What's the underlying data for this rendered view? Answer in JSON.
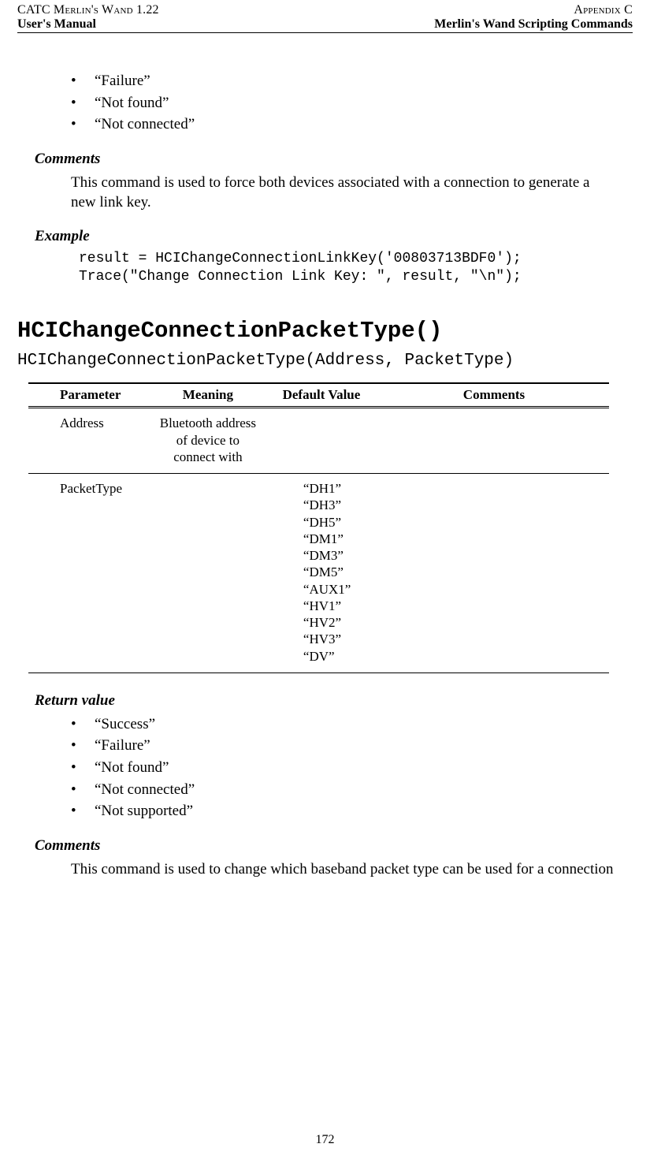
{
  "header": {
    "left_line1": "CATC Merlin's Wand 1.22",
    "left_line2": "User's Manual",
    "right_line1": "Appendix C",
    "right_line2": "Merlin's Wand Scripting Commands"
  },
  "top_bullets": [
    "“Failure”",
    "“Not found”",
    "“Not connected”"
  ],
  "section1": {
    "comments_label": "Comments",
    "comments_text": "This command is used to force both devices associated with a connection to generate a new link key.",
    "example_label": "Example",
    "example_code": "result = HCIChangeConnectionLinkKey('00803713BDF0');\nTrace(\"Change Connection Link Key: \", result, \"\\n\");"
  },
  "section2": {
    "heading": "HCIChangeConnectionPacketType()",
    "signature": "HCIChangeConnectionPacketType(Address, PacketType)",
    "table": {
      "headers": [
        "Parameter",
        "Meaning",
        "Default Value",
        "Comments"
      ],
      "rows": [
        {
          "parameter": "Address",
          "meaning": "Bluetooth address of device to connect with",
          "default_value": "",
          "comments": ""
        },
        {
          "parameter": "PacketType",
          "meaning": "",
          "default_value": "“DH1”\n“DH3”\n“DH5”\n“DM1”\n“DM3”\n“DM5”\n“AUX1”\n“HV1”\n“HV2”\n“HV3”\n“DV”",
          "comments": ""
        }
      ]
    },
    "return_label": "Return value",
    "return_bullets": [
      "“Success”",
      "“Failure”",
      "“Not found”",
      "“Not connected”",
      "“Not supported”"
    ],
    "comments_label": "Comments",
    "comments_text": "This command is used to change which baseband packet type can be used for a connection"
  },
  "page_number": "172"
}
